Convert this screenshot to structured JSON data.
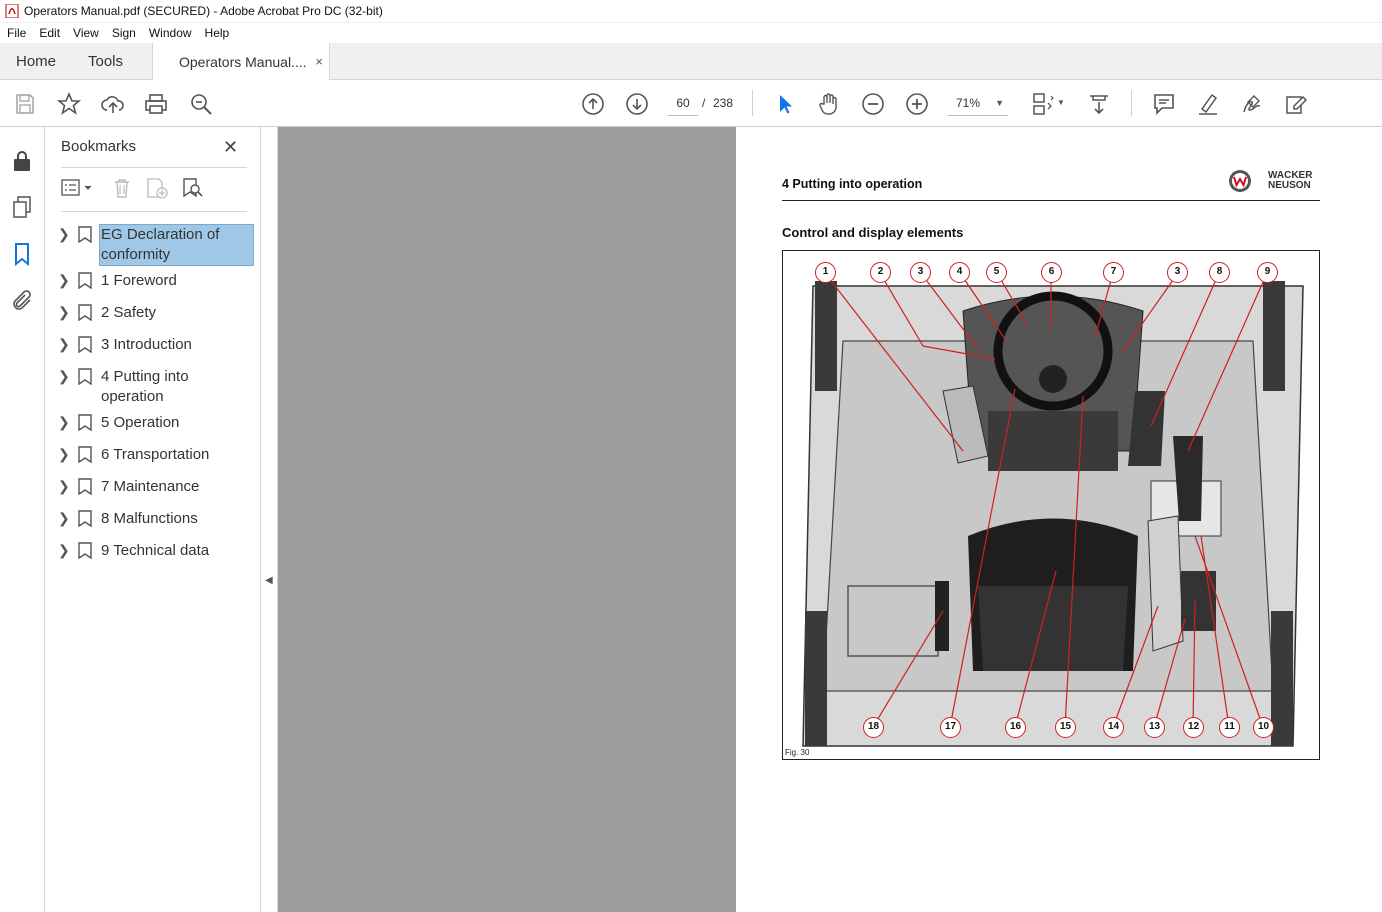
{
  "window": {
    "title": "Operators Manual.pdf (SECURED) - Adobe Acrobat Pro DC (32-bit)"
  },
  "menu": [
    "File",
    "Edit",
    "View",
    "Sign",
    "Window",
    "Help"
  ],
  "tabs": {
    "home": "Home",
    "tools": "Tools",
    "document": "Operators Manual....",
    "close": "×"
  },
  "toolbar": {
    "page_current": "60",
    "page_separator": "/",
    "page_total": "238",
    "zoom": "71%",
    "icons": [
      "save-icon",
      "star-icon",
      "upload-icon",
      "print-icon",
      "zoom-search-icon",
      "page-up-icon",
      "page-down-icon",
      "select-arrow-icon",
      "hand-icon",
      "zoom-out-icon",
      "zoom-in-icon",
      "page-layout-icon",
      "scroll-mode-icon",
      "comment-icon",
      "highlight-icon",
      "sign-icon",
      "edit-pdf-icon"
    ],
    "accent": "#1473e6"
  },
  "bookmarks": {
    "title": "Bookmarks",
    "close": "✕",
    "items": [
      {
        "label": "EG Declaration of conformity",
        "selected": true
      },
      {
        "label": "1 Foreword"
      },
      {
        "label": "2 Safety"
      },
      {
        "label": "3 Introduction"
      },
      {
        "label": "4 Putting into operation"
      },
      {
        "label": "5 Operation"
      },
      {
        "label": "6 Transportation"
      },
      {
        "label": "7 Maintenance"
      },
      {
        "label": "8 Malfunctions"
      },
      {
        "label": "9 Technical data"
      }
    ]
  },
  "page": {
    "header": "4 Putting into operation",
    "logo_text_1": "WACKER",
    "logo_text_2": "NEUSON",
    "section_title": "Control and display elements",
    "figure_label": "Fig. 30",
    "callouts_top": [
      "1",
      "2",
      "3",
      "4",
      "5",
      "6",
      "7",
      "3",
      "8",
      "9"
    ],
    "callouts_bottom": [
      "18",
      "17",
      "16",
      "15",
      "14",
      "13",
      "12",
      "11",
      "10"
    ]
  }
}
